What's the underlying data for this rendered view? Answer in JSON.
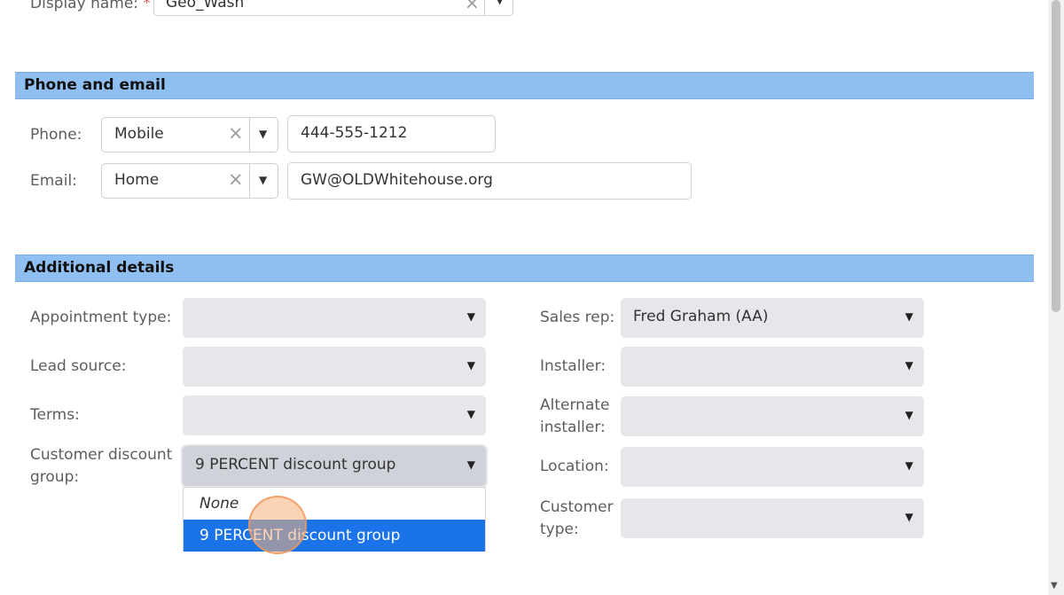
{
  "top": {
    "display_name_label": "Display name:",
    "required_mark": "*",
    "display_name_value": "Geo_Wash"
  },
  "sections": {
    "phone_email": "Phone and email",
    "additional": "Additional details"
  },
  "phone": {
    "label": "Phone:",
    "type": "Mobile",
    "value": "444-555-1212"
  },
  "email": {
    "label": "Email:",
    "type": "Home",
    "value": "GW@OLDWhitehouse.org"
  },
  "details": {
    "appointment_type": {
      "label": "Appointment type:",
      "value": ""
    },
    "lead_source": {
      "label": "Lead source:",
      "value": ""
    },
    "terms": {
      "label": "Terms:",
      "value": ""
    },
    "customer_discount_group": {
      "label_line1": "Customer discount",
      "label_line2": "group:",
      "value": "9 PERCENT discount group"
    },
    "sales_rep": {
      "label": "Sales rep:",
      "value": "Fred Graham (AA)"
    },
    "installer": {
      "label": "Installer:",
      "value": ""
    },
    "alternate_installer": {
      "label_line1": "Alternate",
      "label_line2": "installer:",
      "value": ""
    },
    "location": {
      "label": "Location:",
      "value": ""
    },
    "customer_type": {
      "label_line1": "Customer",
      "label_line2": "type:",
      "value": ""
    }
  },
  "dropdown": {
    "options": [
      "None",
      "9 PERCENT discount group"
    ],
    "selected_index": 1
  },
  "icons": {
    "clear": "×",
    "caret": "▼"
  },
  "colors": {
    "section_header_bg": "#8fbff0",
    "selected_option_bg": "#1a73e8",
    "required": "#d9534f"
  }
}
